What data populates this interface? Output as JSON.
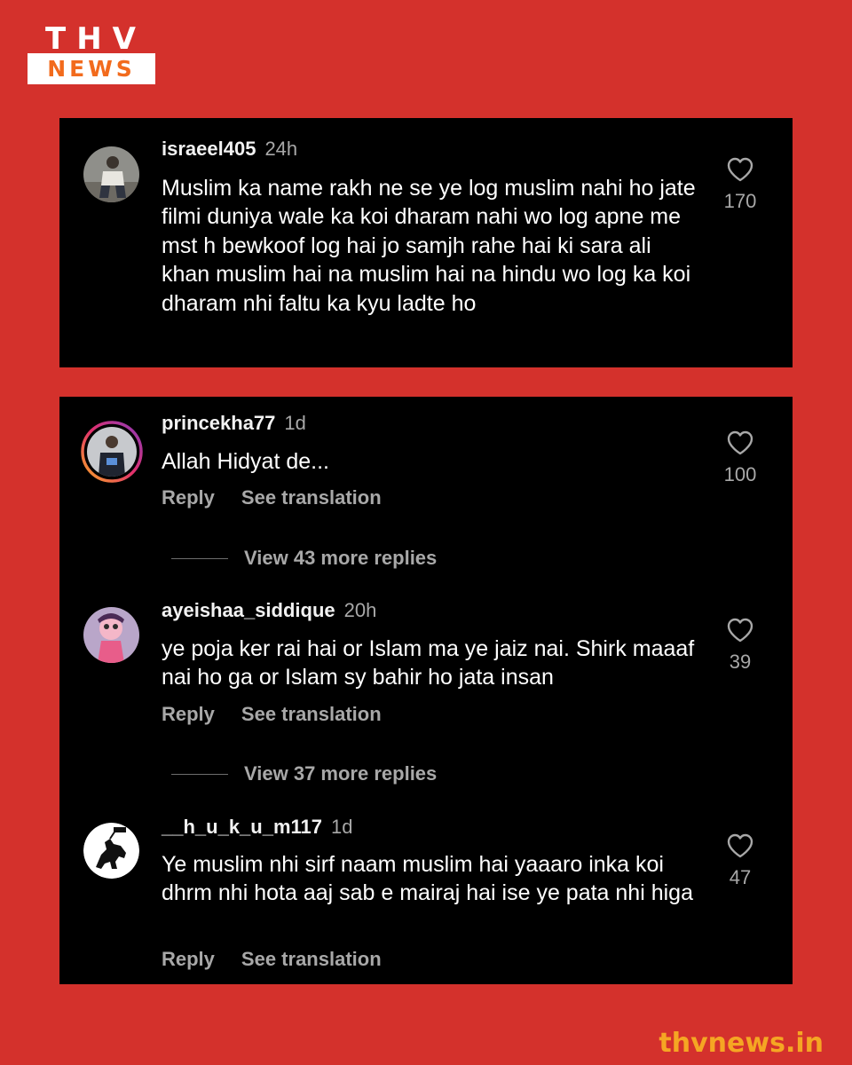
{
  "brand": {
    "logo_top": "THV",
    "logo_bottom": "NEWS",
    "site": "thvnews.in",
    "colors": {
      "background": "#d4312c",
      "logo_accent": "#f26b1d",
      "site_accent": "#f5a623"
    }
  },
  "comments": [
    {
      "username": "israeel405",
      "time": "24h",
      "text": "Muslim ka name rakh ne se ye log muslim nahi ho jate filmi duniya wale ka koi dharam nahi wo log apne me mst h bewkoof log hai jo samjh rahe hai ki sara ali khan muslim hai na muslim hai na hindu wo log ka koi dharam nhi faltu ka kyu ladte ho",
      "likes": "170"
    },
    {
      "username": "princekha77",
      "time": "1d",
      "text": "Allah Hidyat de...",
      "likes": "100",
      "reply": "Reply",
      "translate": "See translation",
      "view_more": "View 43 more replies"
    },
    {
      "username": "ayeishaa_siddique",
      "time": "20h",
      "text": "ye poja ker rai hai  or Islam ma ye jaiz nai. Shirk maaaf nai ho ga or Islam sy bahir ho jata insan",
      "likes": "39",
      "reply": "Reply",
      "translate": "See translation",
      "view_more": "View 37 more replies"
    },
    {
      "username": "__h_u_k_u_m117",
      "time": "1d",
      "text": "Ye muslim nhi sirf naam muslim hai yaaaro inka koi dhrm nhi hota aaj sab e mairaj hai ise ye pata nhi higa",
      "likes": "47",
      "reply": "Reply",
      "translate": "See translation"
    }
  ]
}
